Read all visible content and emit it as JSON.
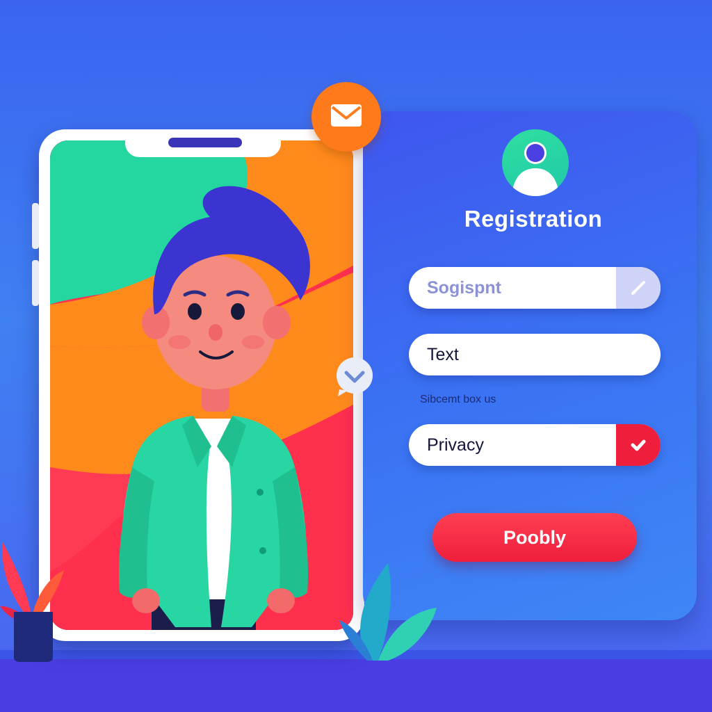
{
  "registration": {
    "title": "Registration",
    "fields": {
      "username_placeholder": "Sogispnt",
      "text_value": "Text",
      "privacy_label": "Privacy"
    },
    "hint": "Sibcemt box us",
    "submit_label": "Poobly"
  },
  "icons": {
    "mail_badge": "envelope-icon",
    "chat_badge": "chevron-down-icon",
    "profile": "user-icon",
    "edit": "pencil-icon",
    "privacy_check": "checkmark-icon"
  },
  "colors": {
    "background": "#3f80f2",
    "card": "#3a72f3",
    "accent_orange": "#ff7a1a",
    "accent_red": "#ef1e3d",
    "accent_green": "#21c8a8",
    "edit_cap": "#cfd3f7"
  }
}
